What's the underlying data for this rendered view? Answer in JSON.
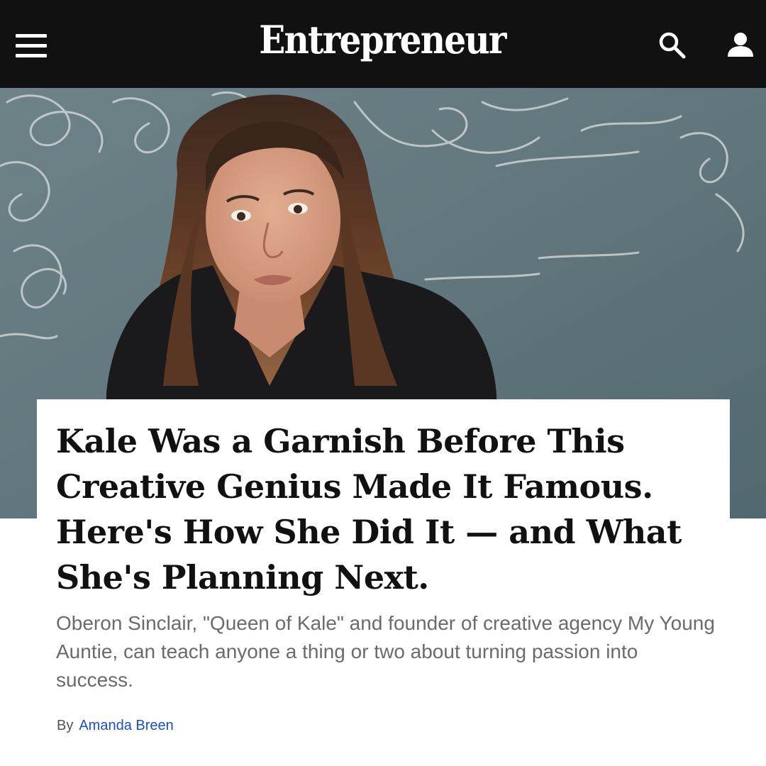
{
  "header": {
    "logo": "Entrepreneur",
    "menu_icon": "hamburger-menu-icon",
    "search_icon": "search-icon",
    "account_icon": "user-account-icon",
    "background": "#111111"
  },
  "hero": {
    "image_icon": "woman-at-chalkboard-photo"
  },
  "article": {
    "headline": "Kale Was a Garnish Before This Creative Genius Made It Famous. Here's How She Did It — and What She's Planning Next.",
    "dek": "Oberon Sinclair, \"Queen of Kale\" and founder of creative agency My Young Auntie, can teach anyone a thing or two about turning passion into success.",
    "byline_prefix": "By",
    "author": "Amanda Breen",
    "author_color": "#1a4fc9"
  }
}
